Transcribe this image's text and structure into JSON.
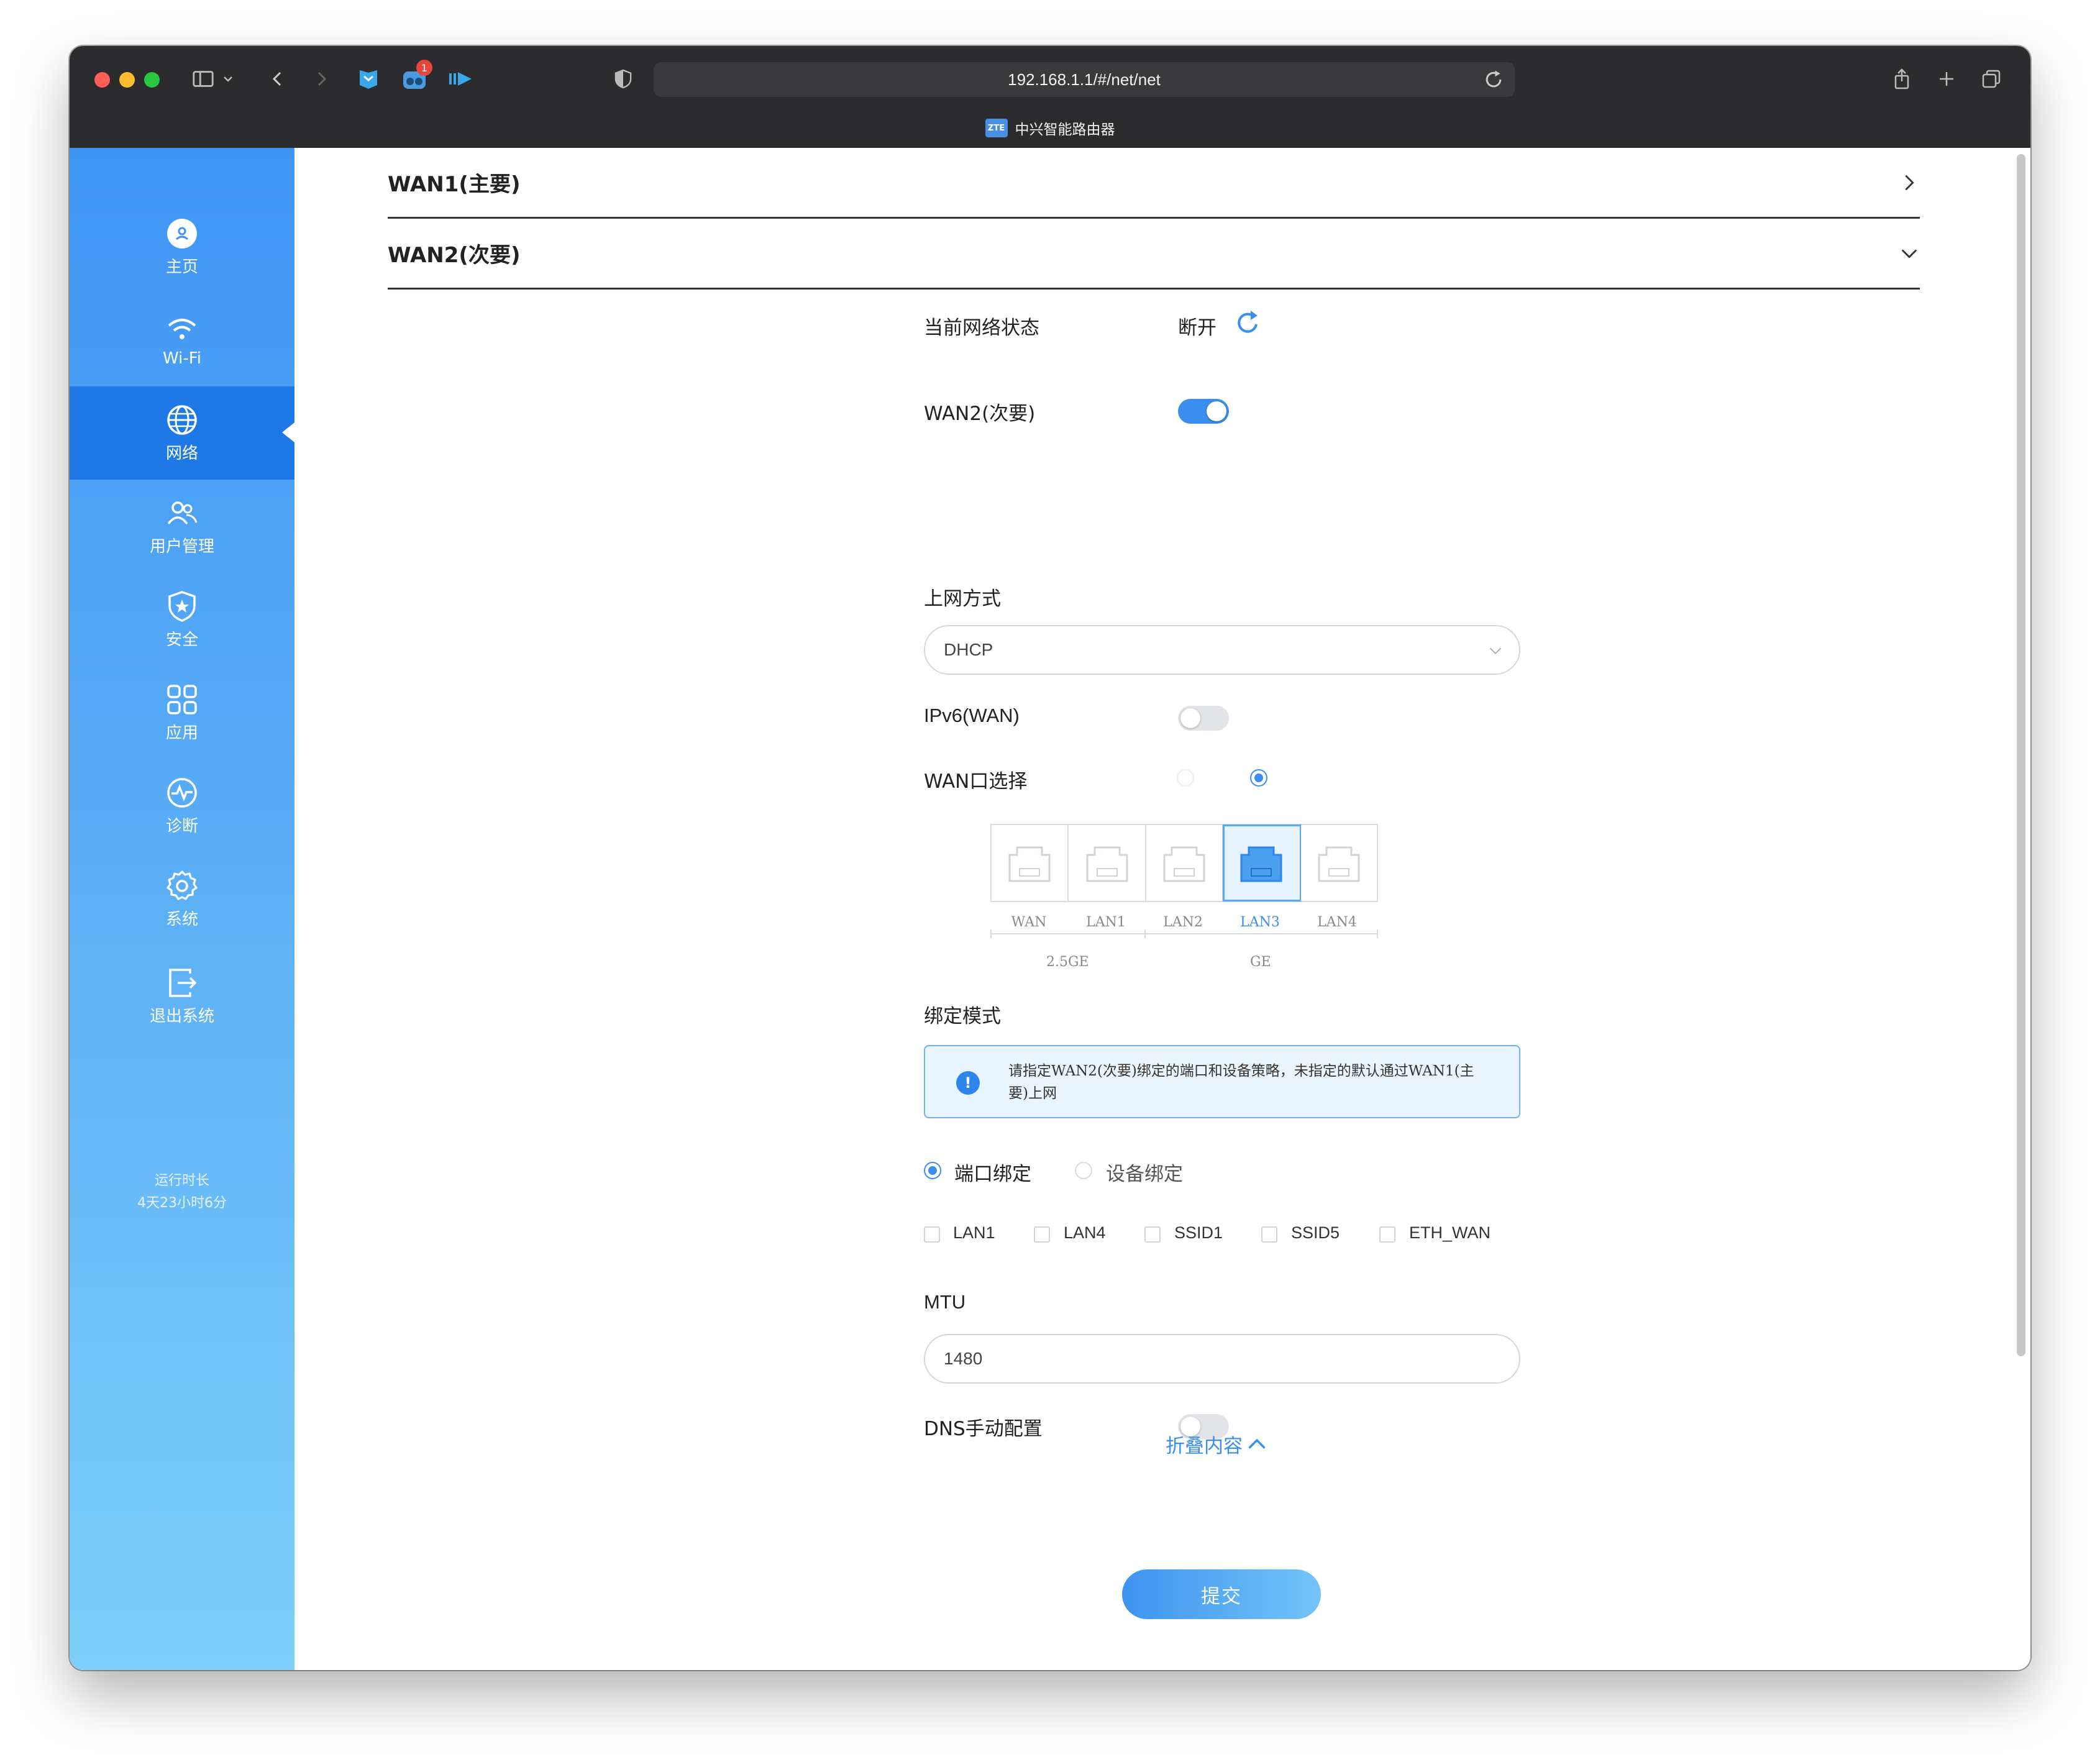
{
  "browser": {
    "url": "192.168.1.1/#/net/net",
    "tab_title": "中兴智能路由器",
    "favicon_text": "ZTE",
    "notification_badge": "1"
  },
  "sidebar": {
    "items": [
      {
        "label": "主页",
        "icon": "home-icon"
      },
      {
        "label": "Wi-Fi",
        "icon": "wifi-icon"
      },
      {
        "label": "网络",
        "icon": "globe-icon"
      },
      {
        "label": "用户管理",
        "icon": "users-icon"
      },
      {
        "label": "安全",
        "icon": "shield-icon"
      },
      {
        "label": "应用",
        "icon": "apps-icon"
      },
      {
        "label": "诊断",
        "icon": "diagnose-icon"
      },
      {
        "label": "系统",
        "icon": "gear-icon"
      },
      {
        "label": "退出系统",
        "icon": "logout-icon"
      }
    ],
    "active_index": 2,
    "uptime_label": "运行时长",
    "uptime_value": "4天23小时6分"
  },
  "accordion": {
    "wan1_title": "WAN1(主要)",
    "wan2_title": "WAN2(次要)"
  },
  "form": {
    "status_label": "当前网络状态",
    "status_value": "断开",
    "wan2_label": "WAN2(次要)",
    "wan2_enabled": true,
    "mode_label": "上网方式",
    "mode_value": "DHCP",
    "ipv6_label": "IPv6(WAN)",
    "ipv6_enabled": false,
    "port_select_label": "WAN口选择",
    "ports": [
      "WAN",
      "LAN1",
      "LAN2",
      "LAN3",
      "LAN4"
    ],
    "selected_port": "LAN3",
    "port_groups": [
      "2.5GE",
      "GE"
    ],
    "bind_mode_label": "绑定模式",
    "bind_notice": "请指定WAN2(次要)绑定的端口和设备策略，未指定的默认通过WAN1(主要)上网",
    "bind_options": [
      "端口绑定",
      "设备绑定"
    ],
    "bind_selected": "端口绑定",
    "bind_checkboxes": [
      "LAN1",
      "LAN4",
      "SSID1",
      "SSID5",
      "ETH_WAN"
    ],
    "mtu_label": "MTU",
    "mtu_value": "1480",
    "dns_label": "DNS手动配置",
    "dns_enabled": false,
    "collapse_label": "折叠内容",
    "submit_label": "提交"
  },
  "colors": {
    "accent": "#3a8eed",
    "sidebar_top": "#3f95f5",
    "sidebar_bottom": "#7ecffb",
    "sidebar_active": "#1e78e6"
  }
}
